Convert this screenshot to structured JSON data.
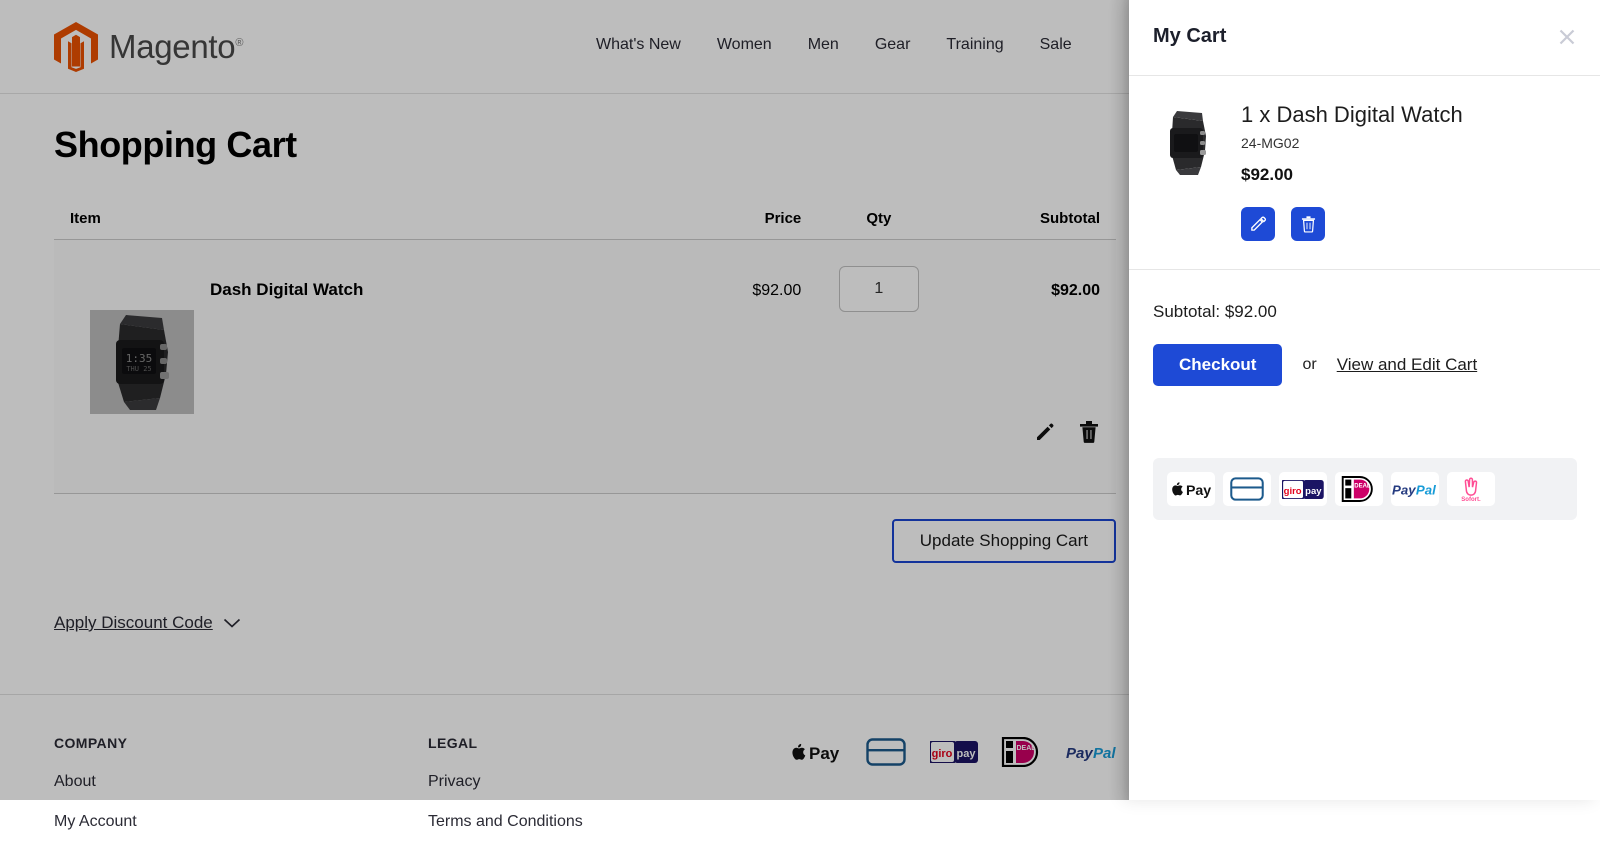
{
  "header": {
    "logo_text": "Magento",
    "logo_reg": "®",
    "nav": [
      {
        "label": "What's New"
      },
      {
        "label": "Women"
      },
      {
        "label": "Men"
      },
      {
        "label": "Gear"
      },
      {
        "label": "Training"
      },
      {
        "label": "Sale"
      }
    ]
  },
  "main": {
    "page_title": "Shopping Cart",
    "table": {
      "columns": [
        "Item",
        "Price",
        "Qty",
        "Subtotal"
      ],
      "rows": [
        {
          "name": "Dash Digital Watch",
          "price": "$92.00",
          "qty": "1",
          "subtotal": "$92.00"
        }
      ]
    },
    "update_button": "Update Shopping Cart",
    "discount_link": "Apply Discount Code"
  },
  "footer": {
    "columns": [
      {
        "heading": "COMPANY",
        "links": [
          "About",
          "My Account"
        ]
      },
      {
        "heading": "LEGAL",
        "links": [
          "Privacy",
          "Terms and Conditions"
        ]
      }
    ],
    "payment_methods": [
      "apple-pay",
      "generic-card",
      "giropay",
      "ideal",
      "paypal"
    ]
  },
  "cart_drawer": {
    "title": "My Cart",
    "close_label": "×",
    "item": {
      "name": "1 x Dash Digital Watch",
      "sku": "24-MG02",
      "price": "$92.00",
      "edit_label": "edit",
      "remove_label": "remove"
    },
    "subtotal_label": "Subtotal: $92.00",
    "checkout_label": "Checkout",
    "or_label": "or",
    "view_edit_label": "View and Edit Cart",
    "payment_methods": [
      "apple-pay",
      "generic-card",
      "giropay",
      "ideal",
      "paypal",
      "sofort"
    ]
  },
  "colors": {
    "brand_orange": "#eb5202",
    "accent_blue": "#1e4ad6",
    "text_dark": "#1c1f2b",
    "panel_bg": "#ffffff",
    "pay_strip_bg": "#f1f2f4"
  }
}
